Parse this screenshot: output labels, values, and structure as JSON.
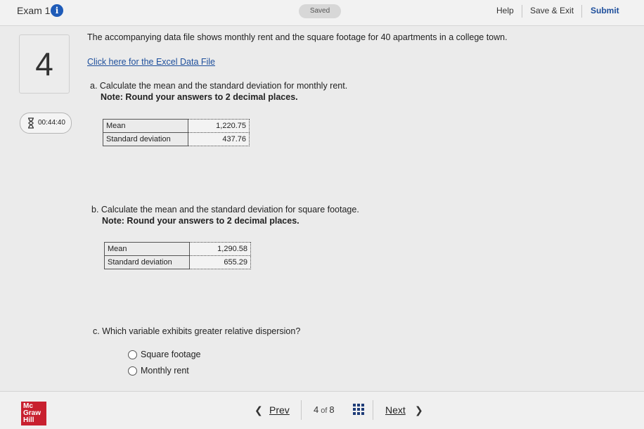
{
  "header": {
    "exam_title": "Exam 1",
    "info_icon": "i",
    "saved": "Saved",
    "help": "Help",
    "save_exit": "Save & Exit",
    "submit": "Submit"
  },
  "question": {
    "number": "4",
    "timer": "00:44:40",
    "intro": "The accompanying data file shows monthly rent and the square footage for 40 apartments in a college town.",
    "data_link": "Click here for the Excel Data File",
    "part_a": {
      "prompt": "a. Calculate the mean and the standard deviation for monthly rent.",
      "note": "Note: Round your answers to 2 decimal places.",
      "rows": [
        {
          "label": "Mean",
          "value": "1,220.75"
        },
        {
          "label": "Standard deviation",
          "value": "437.76"
        }
      ]
    },
    "part_b": {
      "prompt": "b. Calculate the mean and the standard deviation for square footage.",
      "note": "Note: Round your answers to 2 decimal places.",
      "rows": [
        {
          "label": "Mean",
          "value": "1,290.58"
        },
        {
          "label": "Standard deviation",
          "value": "655.29"
        }
      ]
    },
    "part_c": {
      "prompt": "c. Which variable exhibits greater relative dispersion?",
      "options": [
        "Square footage",
        "Monthly rent"
      ]
    }
  },
  "footer": {
    "logo_lines": [
      "Mc",
      "Graw",
      "Hill"
    ],
    "prev": "Prev",
    "current": "4",
    "of": "of",
    "total": "8",
    "next": "Next"
  },
  "icons": {
    "info": "info-icon",
    "timer": "hourglass-icon",
    "grid": "grid-icon",
    "prev": "chevron-left-icon",
    "next": "chevron-right-icon"
  },
  "colors": {
    "accent_blue": "#1e4f9c",
    "logo_red": "#c8202f"
  }
}
